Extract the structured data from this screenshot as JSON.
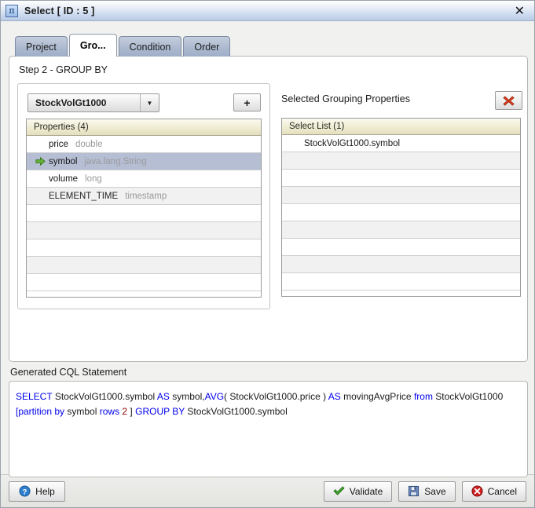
{
  "window": {
    "title": "Select [ ID : 5 ]",
    "icon": "pi-icon",
    "icon_glyph": "π",
    "close_label": "✕"
  },
  "tabs": [
    {
      "label": "Project",
      "name": "tab-project",
      "active": false
    },
    {
      "label": "Gro...",
      "name": "tab-group-by",
      "active": true
    },
    {
      "label": "Condition",
      "name": "tab-condition",
      "active": false
    },
    {
      "label": "Order",
      "name": "tab-order",
      "active": false
    }
  ],
  "main": {
    "step_title": "Step 2 - GROUP BY",
    "left": {
      "combo_value": "StockVolGt1000",
      "combo_arrow": "▼",
      "add_button_label": "+",
      "list_header": "Properties (4)",
      "rows": [
        {
          "selected": false,
          "arrow": "",
          "name": "price",
          "type": "double"
        },
        {
          "selected": true,
          "arrow": "➡",
          "name": "symbol",
          "type": "java.lang.String"
        },
        {
          "selected": false,
          "arrow": "",
          "name": "volume",
          "type": "long"
        },
        {
          "selected": false,
          "arrow": "",
          "name": "ELEMENT_TIME",
          "type": "timestamp"
        },
        {
          "selected": false,
          "arrow": "",
          "name": "",
          "type": ""
        },
        {
          "selected": false,
          "arrow": "",
          "name": "",
          "type": ""
        },
        {
          "selected": false,
          "arrow": "",
          "name": "",
          "type": ""
        },
        {
          "selected": false,
          "arrow": "",
          "name": "",
          "type": ""
        }
      ]
    },
    "right": {
      "title": "Selected Grouping Properties",
      "delete_button_name": "remove-button",
      "list_header": "Select List (1)",
      "rows": [
        {
          "name": "StockVolGt1000.symbol"
        },
        {
          "name": ""
        },
        {
          "name": ""
        },
        {
          "name": ""
        },
        {
          "name": ""
        },
        {
          "name": ""
        },
        {
          "name": ""
        },
        {
          "name": ""
        }
      ]
    }
  },
  "cql": {
    "label": "Generated CQL Statement",
    "statement": "SELECT StockVolGt1000.symbol AS symbol,AVG( StockVolGt1000.price ) AS movingAvgPrice from  StockVolGt1000 [partition by  symbol  rows 2 ] GROUP BY StockVolGt1000.symbol",
    "tokens": [
      {
        "t": "SELECT ",
        "k": "kw"
      },
      {
        "t": "StockVolGt1000.symbol ",
        "k": "plain"
      },
      {
        "t": "AS ",
        "k": "kw"
      },
      {
        "t": "symbol,",
        "k": "plain"
      },
      {
        "t": "AVG",
        "k": "kw"
      },
      {
        "t": "( StockVolGt1000.price )",
        "k": "plain"
      },
      {
        "t": " AS ",
        "k": "kw"
      },
      {
        "t": "movingAvgPrice ",
        "k": "plain"
      },
      {
        "t": "from",
        "k": "kw"
      },
      {
        "t": "  StockVolGt1000",
        "k": "plain"
      },
      {
        "t": "\n",
        "k": "br"
      },
      {
        "t": "[partition by",
        "k": "kw"
      },
      {
        "t": "  symbol  ",
        "k": "plain"
      },
      {
        "t": "rows ",
        "k": "kw"
      },
      {
        "t": "2",
        "k": "num"
      },
      {
        "t": " ] ",
        "k": "plain"
      },
      {
        "t": "GROUP BY ",
        "k": "kw"
      },
      {
        "t": "StockVolGt1000.symbol",
        "k": "plain"
      }
    ]
  },
  "footer": {
    "help": "Help",
    "validate": "Validate",
    "save": "Save",
    "cancel": "Cancel"
  },
  "colors": {
    "accent_blue": "#0000ee",
    "number_red": "#8b0000",
    "selection": "#b6bed4",
    "header_cream": "#efecd2",
    "green_arrow": "#4a9a2a",
    "red_x": "#d83a1e"
  }
}
